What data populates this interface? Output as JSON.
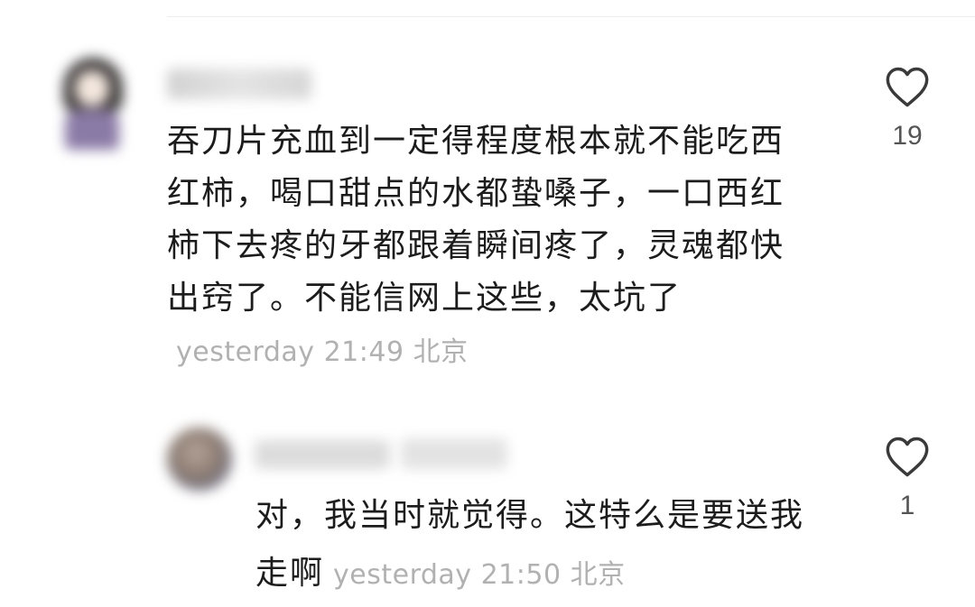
{
  "comment": {
    "text": "吞刀片充血到一定得程度根本就不能吃西红柿，喝口甜点的水都蛰嗓子，一口西红柿下去疼的牙都跟着瞬间疼了，灵魂都快出窍了。不能信网上这些，太坑了",
    "time": "yesterday 21:49 北京",
    "likes": "19",
    "like_icon": "heart-outline-icon"
  },
  "reply": {
    "text": "对，我当时就觉得。这特么是要送我走啊",
    "time": "yesterday 21:50 北京",
    "likes": "1",
    "like_icon": "heart-outline-icon"
  },
  "colors": {
    "text": "#1c1c1c",
    "meta": "#b1b1b1",
    "icon": "#3a3a3a"
  }
}
